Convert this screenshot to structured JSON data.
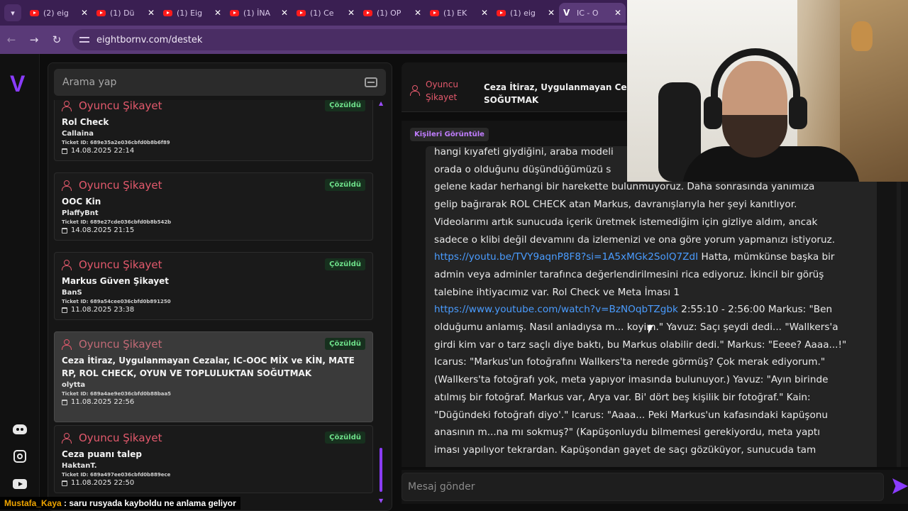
{
  "browser": {
    "tabs": [
      {
        "label": "(2) eig",
        "icon": "youtube"
      },
      {
        "label": "(1) Dü",
        "icon": "youtube"
      },
      {
        "label": "(1) Eig",
        "icon": "youtube"
      },
      {
        "label": "(1) İNA",
        "icon": "youtube"
      },
      {
        "label": "(1) Ce",
        "icon": "youtube"
      },
      {
        "label": "(1) OP",
        "icon": "youtube"
      },
      {
        "label": "(1) EK",
        "icon": "youtube"
      },
      {
        "label": "(1) eig",
        "icon": "youtube"
      },
      {
        "label": "IC - O",
        "icon": "eightborn-v",
        "active": true
      }
    ],
    "url": "eightbornv.com/destek"
  },
  "rail": {
    "brand": "V",
    "icons": [
      "discord-icon",
      "instagram-icon",
      "youtube-icon"
    ]
  },
  "search": {
    "placeholder": "Arama yap"
  },
  "tickets": [
    {
      "category": "Oyuncu Şikayet",
      "status": "Çözüldü",
      "title": "Rol Check",
      "user": "Callaina",
      "ticket_id": "Ticket ID: 689e35a2e036cbfd0b8b6f89",
      "date": "14.08.2025 22:14"
    },
    {
      "category": "Oyuncu Şikayet",
      "status": "Çözüldü",
      "title": "OOC Kin",
      "user": "PlaffyBnt",
      "ticket_id": "Ticket ID: 689e27cde036cbfd0b8b542b",
      "date": "14.08.2025 21:15"
    },
    {
      "category": "Oyuncu Şikayet",
      "status": "Çözüldü",
      "title": "Markus Güven Şikayet",
      "user": "BanS",
      "ticket_id": "Ticket ID: 689a54cee036cbfd0b891250",
      "date": "11.08.2025 23:38"
    },
    {
      "category": "Oyuncu Şikayet",
      "status": "Çözüldü",
      "title_line1": "Ceza İtiraz, Uygulanmayan Cezalar, IC-OOC MİX ve KİN, MATE",
      "title_line2": "RP, ROL CHECK, OYUN VE TOPLULUKTAN SOĞUTMAK",
      "user": "olytta",
      "ticket_id": "Ticket ID: 689a4ae9e036cbfd0b88baa5",
      "date": "11.08.2025 22:56",
      "selected": true
    },
    {
      "category": "Oyuncu Şikayet",
      "status": "Çözüldü",
      "title": "Ceza puanı talep",
      "user": "HaktanT.",
      "ticket_id": "Ticket ID: 689a497ee036cbfd0b889ece",
      "date": "11.08.2025 22:50"
    }
  ],
  "chat": {
    "header_category_line1": "Oyuncu",
    "header_category_line2": "Şikayet",
    "header_title_line1": "Ceza İtiraz, Uygulanmayan Cezala",
    "header_title_line2": "SOĞUTMAK",
    "view_people_button": "Kişileri Görüntüle",
    "message": {
      "line1": "hangi kıyafeti giydiğini, araba modeli",
      "line2": "orada o olduğunu düşündüğümüzü s",
      "line3": "gelene kadar herhangi bir harekette bulunmuyoruz. Daha sonrasında yanımıza",
      "line4": "gelip bağırarak ROL CHECK atan Markus, davranışlarıyla her şeyi kanıtlıyor.",
      "line5": "Videolarımı artık sunucuda içerik üretmek istemediğim için gizliye aldım, ancak",
      "line6": "sadece o klibi değil devamını da izlemenizi ve ona göre yorum yapmanızı istiyoruz.",
      "link1": "https://youtu.be/TVY9aqnP8F8?si=1A5xMGk2SoIQ7ZdI",
      "line7a": " Hatta, mümkünse başka bir",
      "line8": "admin veya adminler tarafınca değerlendirilmesini rica ediyoruz. İkincil bir görüş",
      "line9": "talebine ihtiyacımız var. Rol Check ve Meta İması 1",
      "link2": "https://www.youtube.com/watch?v=BzNOqbTZgbk",
      "line10a": " 2:55:10 - 2:56:00 Markus: \"Ben",
      "line11": "olduğumu anlamış. Nasıl anladıysa m... koyim.\" Yavuz: Saçı şeydi dedi... \"Wallkers'a",
      "line12": "girdi kim var o tarz saçlı diye baktı, bu Markus olabilir dedi.\" Markus: \"Eeee? Aaaa...!\"",
      "line13": "Icarus: \"Markus'un fotoğrafını Wallkers'ta nerede görmüş? Çok merak ediyorum.\"",
      "line14": "(Wallkers'ta fotoğrafı yok, meta yapıyor imasında bulunuyor.) Yavuz: \"Ayın birinde",
      "line15": "atılmış bir fotoğraf. Markus var, Arya var. Bi' dört beş kişilik bir fotoğraf.\" Kain:",
      "line16": "\"Düğündeki fotoğrafı diyo'.\" Icarus: \"Aaaa... Peki Markus'un kafasındaki kapüşonu",
      "line17": "anasının m...na mı sokmuş?\" (Kapüşonluydu bilmemesi gerekiyordu, meta yaptı",
      "line18": "iması yapılıyor tekrardan. Kapüşondan gayet de saçı gözüküyor, sunucuda tam"
    },
    "compose_placeholder": "Mesaj gönder"
  },
  "stream_chat": {
    "user": "Mustafa_Kaya",
    "separator": " : ",
    "text": "saru rusyada kayboldu ne anlama geliyor"
  },
  "colors": {
    "accent": "#8a3cff",
    "category": "#e3596c",
    "resolved": "#6ee08a",
    "link": "#4a9cff",
    "tabbar": "#3a1f52"
  }
}
